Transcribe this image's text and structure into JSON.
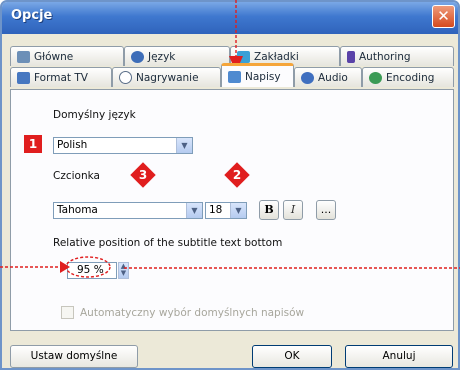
{
  "window": {
    "title": "Opcje",
    "close_symbol": "✕"
  },
  "tabs": {
    "row1": [
      {
        "label": "Główne",
        "icon": "gear-icon",
        "color": "#6c8fb7"
      },
      {
        "label": "Język",
        "icon": "globe-icon",
        "color": "#3d6db8"
      },
      {
        "label": "Zakładki",
        "icon": "bookmark-icon",
        "color": "#3aa0d6"
      },
      {
        "label": "Authoring",
        "icon": "pen-icon",
        "color": "#5a42a8"
      }
    ],
    "row2": [
      {
        "label": "Format TV",
        "icon": "tv-icon",
        "color": "#4677c0"
      },
      {
        "label": "Nagrywanie",
        "icon": "record-icon",
        "color": "#5a6e88"
      },
      {
        "label": "Napisy",
        "icon": "subtitles-icon",
        "color": "#4f8ad0",
        "active": true
      },
      {
        "label": "Audio",
        "icon": "audio-icon",
        "color": "#3f6fbf"
      },
      {
        "label": "Encoding",
        "icon": "encoding-icon",
        "color": "#3b9b55"
      }
    ]
  },
  "subtitles": {
    "default_language_label": "Domyślny język",
    "default_language_value": "Polish",
    "font_label": "Czcionka",
    "font_value": "Tahoma",
    "font_size_value": "18",
    "bold_label": "B",
    "italic_label": "I",
    "more_label": "...",
    "position_label": "Relative position of the subtitle text bottom",
    "position_value": "95 %",
    "auto_select_label": "Automatyczny wybór domyślnych napisów",
    "auto_select_checked": false
  },
  "callouts": {
    "one": "1",
    "two": "2",
    "three": "3"
  },
  "buttons": {
    "defaults": "Ustaw domyślne",
    "ok": "OK",
    "cancel": "Anuluj"
  },
  "colors": {
    "callout": "#e01e1e",
    "active_tab_accent": "#f5a53a"
  }
}
